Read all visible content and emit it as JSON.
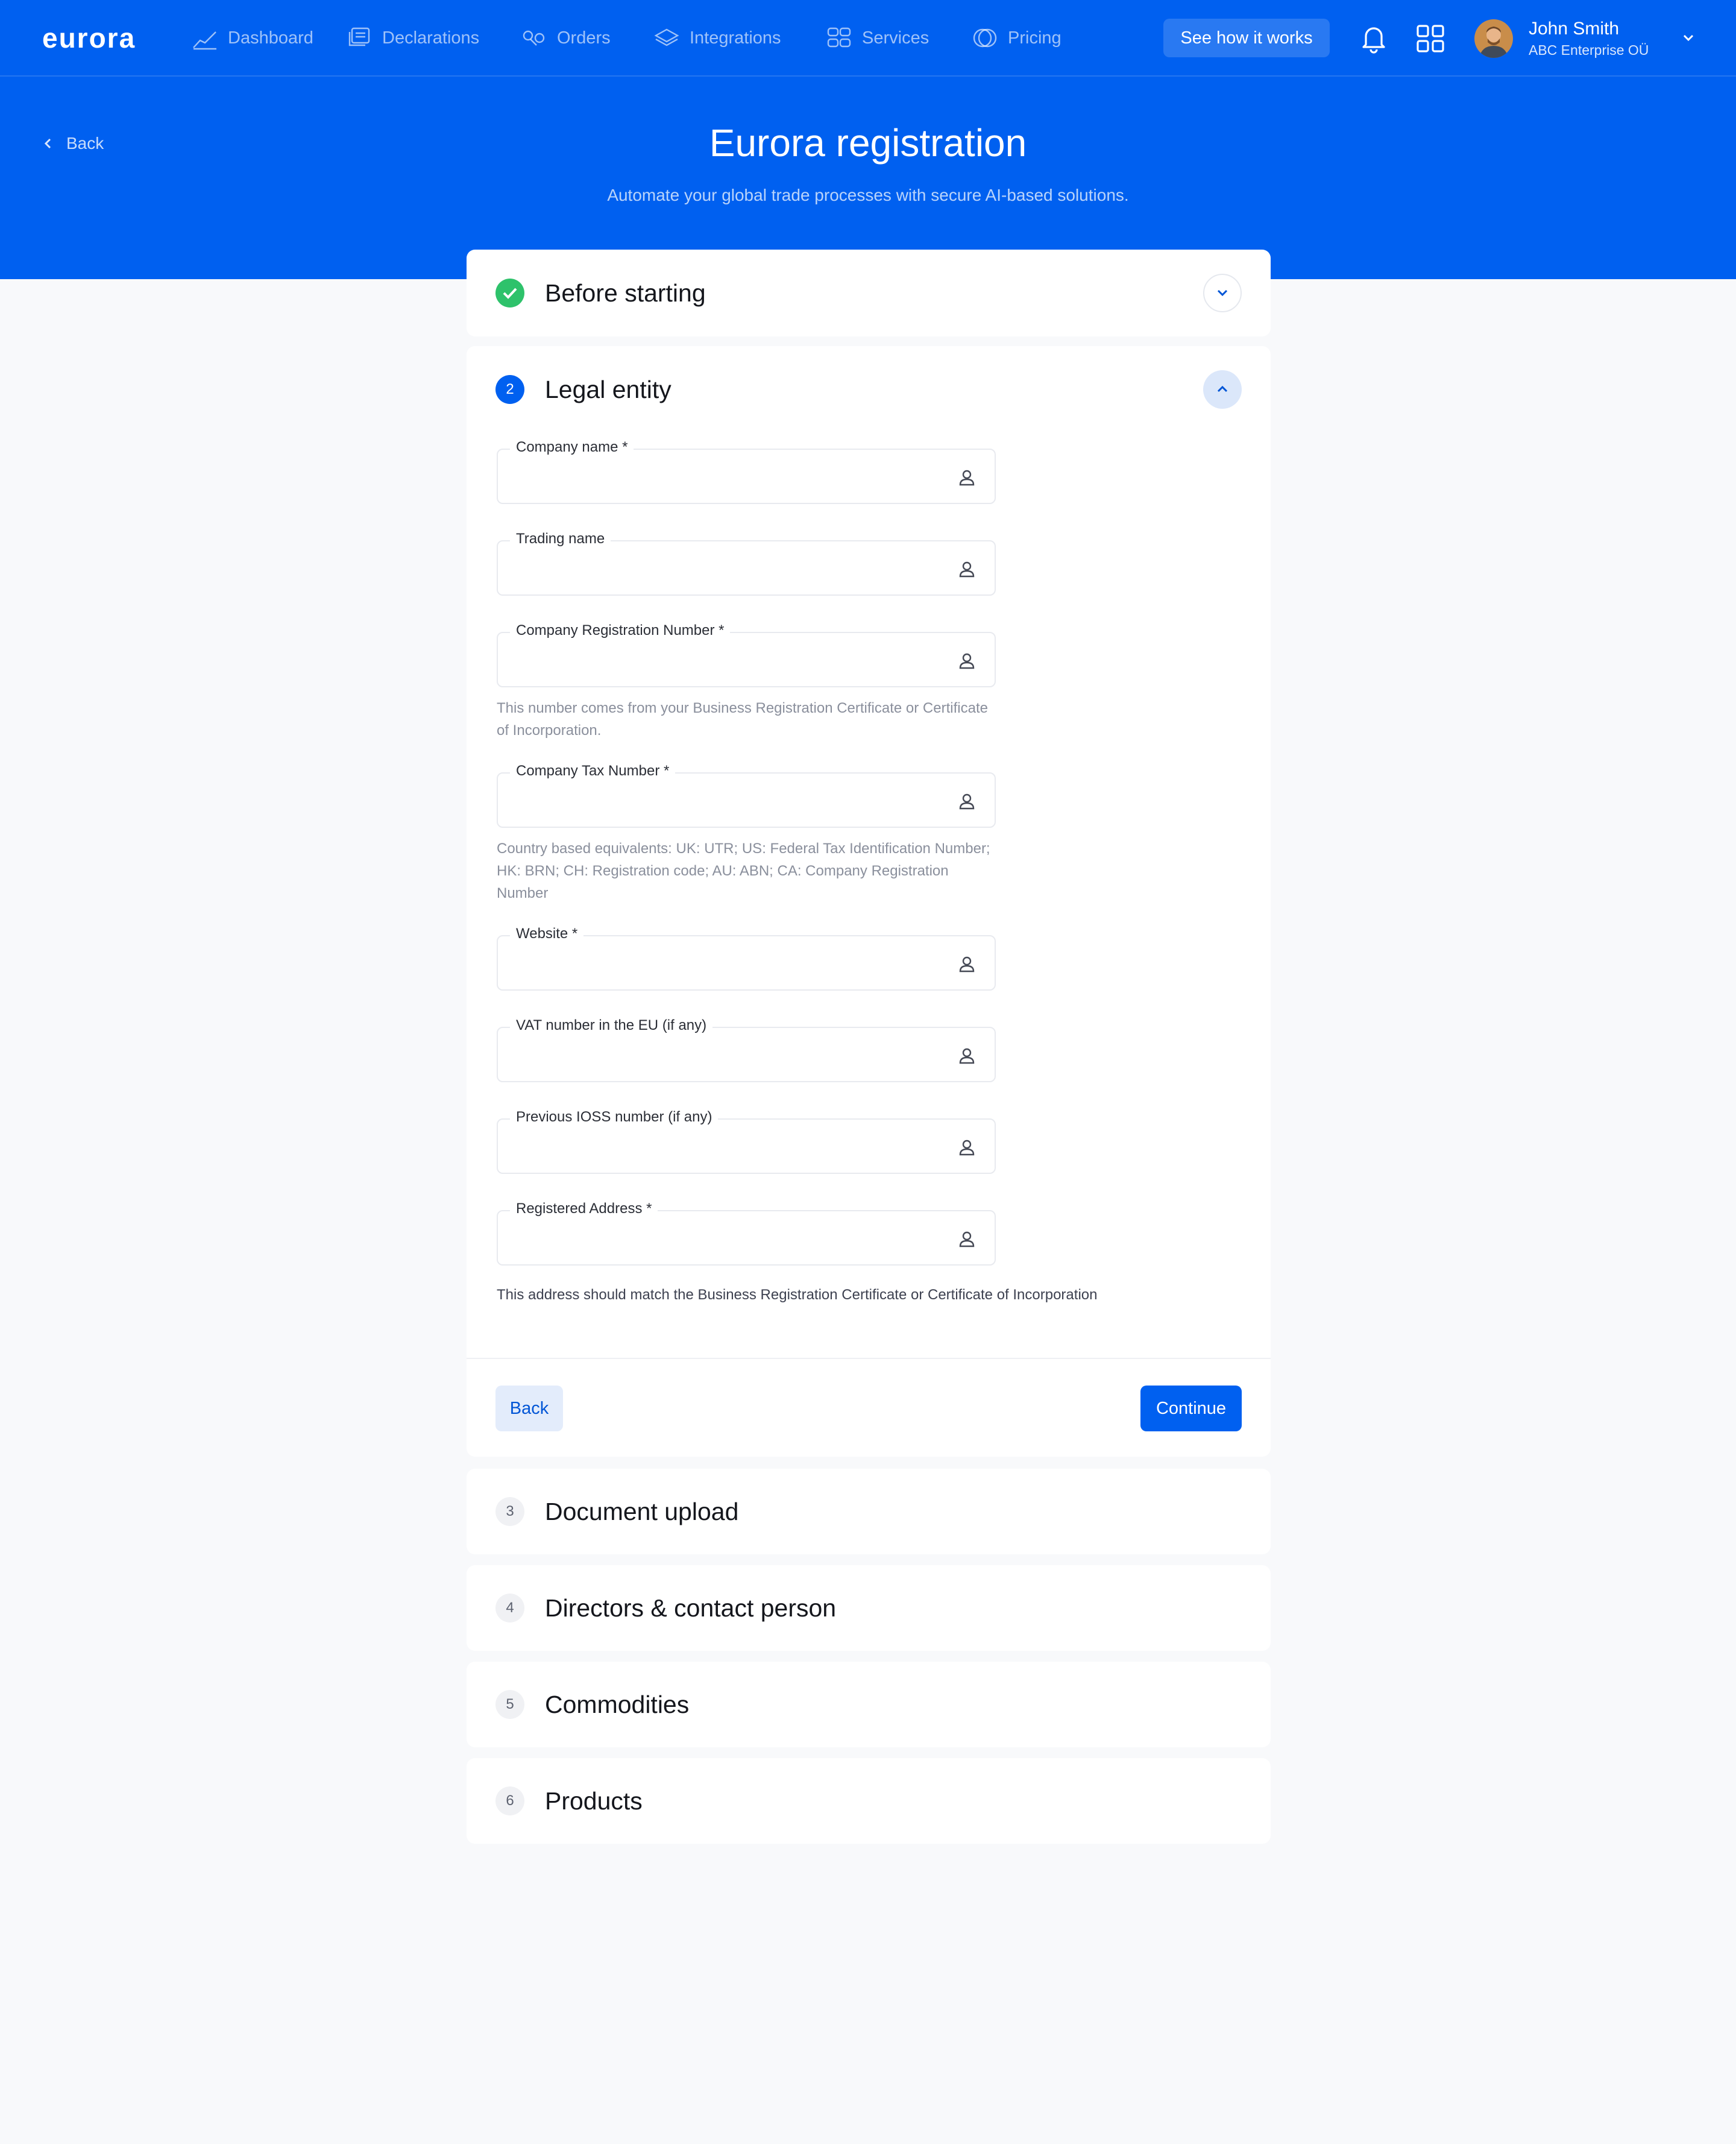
{
  "brand": {
    "logo_text": "eurora",
    "primary_color": "#0060f0",
    "success_color": "#2ec26b"
  },
  "nav": {
    "items": [
      {
        "label": "Dashboard",
        "icon": "chart-line-icon"
      },
      {
        "label": "Declarations",
        "icon": "documents-icon"
      },
      {
        "label": "Orders",
        "icon": "orders-icon"
      },
      {
        "label": "Integrations",
        "icon": "layers-icon"
      },
      {
        "label": "Services",
        "icon": "services-grid-icon"
      },
      {
        "label": "Pricing",
        "icon": "coins-icon"
      }
    ],
    "cta_label": "See how it works"
  },
  "user": {
    "name": "John Smith",
    "company": "ABC Enterprise OÜ"
  },
  "header": {
    "back_label": "Back",
    "title": "Eurora registration",
    "subtitle": "Automate your global trade processes with secure AI-based solutions."
  },
  "steps": [
    {
      "number": "1",
      "title": "Before starting",
      "status": "done"
    },
    {
      "number": "2",
      "title": "Legal entity",
      "status": "active"
    },
    {
      "number": "3",
      "title": "Document upload",
      "status": "todo"
    },
    {
      "number": "4",
      "title": "Directors & contact person",
      "status": "todo"
    },
    {
      "number": "5",
      "title": "Commodities",
      "status": "todo"
    },
    {
      "number": "6",
      "title": "Products",
      "status": "todo"
    }
  ],
  "form": {
    "fields": [
      {
        "label": "Company name *",
        "value": "",
        "hint": ""
      },
      {
        "label": "Trading name",
        "value": "",
        "hint": ""
      },
      {
        "label": "Company Registration Number *",
        "value": "",
        "hint": "This number comes from your Business Registration Certificate or Certificate of Incorporation."
      },
      {
        "label": "Company Tax Number *",
        "value": "",
        "hint": "Country based equivalents: UK: UTR; US: Federal Tax Identification Number; HK: BRN; CH: Registration code; AU: ABN; CA: Company Registration Number"
      },
      {
        "label": "Website *",
        "value": "",
        "hint": ""
      },
      {
        "label": "VAT number in the EU (if any)",
        "value": "",
        "hint": ""
      },
      {
        "label": "Previous IOSS number (if any)",
        "value": "",
        "hint": ""
      },
      {
        "label": "Registered Address  *",
        "value": "",
        "hint": ""
      }
    ],
    "address_note": "This address should match the Business Registration Certificate or Certificate of Incorporation",
    "back_label": "Back",
    "continue_label": "Continue"
  }
}
